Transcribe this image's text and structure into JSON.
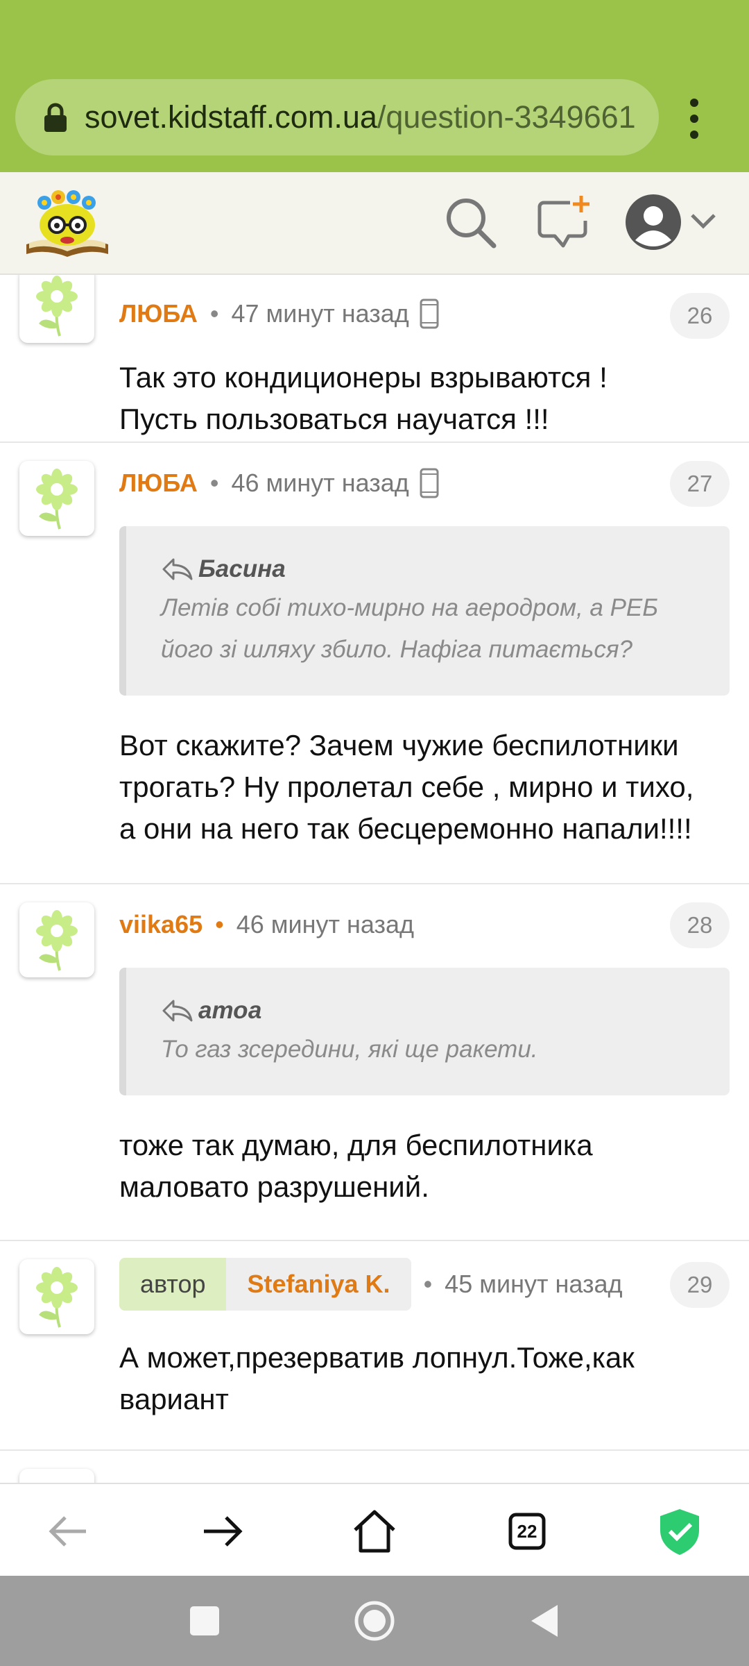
{
  "browser": {
    "url_host": "sovet.kidstaff.com.ua",
    "url_path": "/question-3349661",
    "tab_count": "22",
    "icons": [
      "lock-icon",
      "menu-dots-icon",
      "back-arrow-icon",
      "forward-arrow-icon",
      "home-icon",
      "tabs-icon",
      "shield-check-icon"
    ]
  },
  "header": {
    "icons": [
      "search-icon",
      "new-message-icon",
      "user-avatar-icon",
      "chevron-down-icon"
    ]
  },
  "comments": [
    {
      "number": "26",
      "author": "ЛЮБА",
      "time": "47 минут назад",
      "mobile": true,
      "body_lines": [
        "Так это кондиционеры взрываются !",
        "Пусть пользоваться научатся !!!"
      ]
    },
    {
      "number": "27",
      "author": "ЛЮБА",
      "time": "46 минут назад",
      "mobile": true,
      "quote": {
        "author": "Басина",
        "lines": [
          "Летів собі тихо-мирно на аеродром, а РЕБ",
          "його зі шляху збило. Нафіга питається?"
        ]
      },
      "body_lines": [
        "Вот скажите? Зачем чужие беспилотники",
        "трогать? Ну пролетал себе , мирно и тихо,",
        "а они на него так бесцеремонно напали!!!!"
      ]
    },
    {
      "number": "28",
      "author": "viika65",
      "time": "46 минут назад",
      "mobile": false,
      "quote": {
        "author": "атоа",
        "lines": [
          "То газ зсередини, які ще ракети."
        ]
      },
      "body_lines": [
        "тоже так думаю, для беспилотника",
        "маловато разрушений."
      ]
    },
    {
      "number": "29",
      "author_role": "автор",
      "author": "Stefaniya K.",
      "time": "45 минут назад",
      "mobile": false,
      "body_lines": [
        "А может,презерватив лопнул.Тоже,как",
        "вариант"
      ]
    }
  ],
  "colors": {
    "browser_bar": "#9bc34a",
    "author": "#e07a14",
    "header_bg": "#f4f4ec",
    "shield": "#2ecc71"
  }
}
